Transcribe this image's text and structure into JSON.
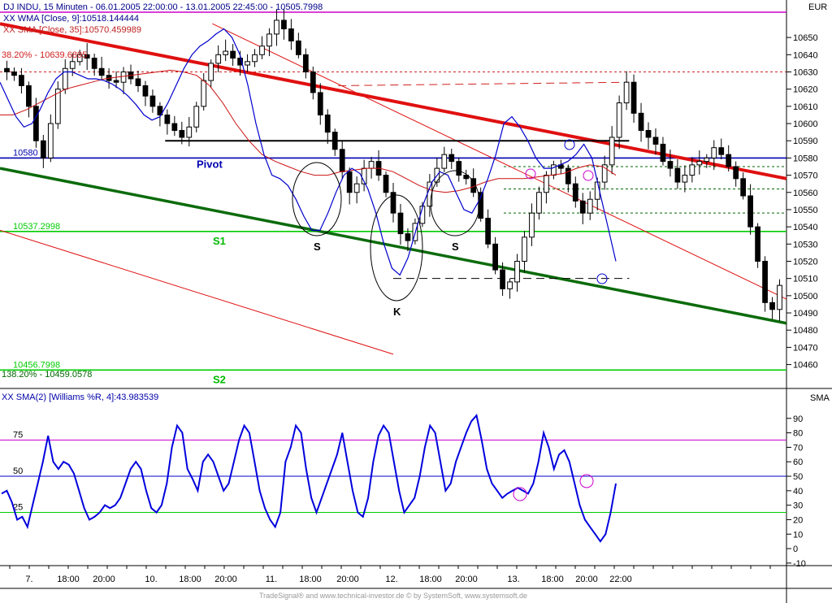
{
  "chart_data": [
    {
      "type": "candlestick",
      "header": {
        "title_lines": [
          "DJ INDU, 15 Minuten - 06.01.2005 22:00:00 - 13.01.2005 22:45:00 - 10505.7998",
          "XX WMA [Close, 9]:10518.144444",
          "XX SMA [Close, 35]:10570.459989"
        ],
        "currency": "EUR",
        "fib_top": "38.20% - 10639.6895",
        "fib_bottom": "138.20% - 10459.0578"
      },
      "y_ticks": [
        10460,
        10470,
        10480,
        10490,
        10500,
        10510,
        10520,
        10530,
        10540,
        10550,
        10560,
        10570,
        10580,
        10590,
        10600,
        10610,
        10620,
        10630,
        10640,
        10650
      ],
      "ylim": [
        10448,
        10668
      ],
      "levels": [
        {
          "name": "Pivot",
          "value": 10580,
          "label": "10580",
          "color": "#0000b0"
        },
        {
          "name": "S1",
          "value": 10537.2998,
          "label": "10537.2998",
          "color": "#00cc00"
        },
        {
          "name": "S2",
          "value": 10456.7998,
          "label": "10456.7998",
          "color": "#00cc00"
        }
      ],
      "level_names": {
        "pivot": "Pivot",
        "s1": "S1",
        "s2": "S2"
      },
      "pattern_labels": [
        "S",
        "K",
        "S"
      ],
      "x_labels": [
        "7.",
        "18:00",
        "20:00",
        "10.",
        "18:00",
        "20:00",
        "11.",
        "18:00",
        "20:00",
        "12.",
        "18:00",
        "20:00",
        "13.",
        "18:00",
        "20:00",
        "22:00"
      ],
      "close_path": [
        10630,
        10628,
        10622,
        10610,
        10590,
        10580,
        10600,
        10620,
        10632,
        10636,
        10640,
        10638,
        10632,
        10628,
        10625,
        10624,
        10630,
        10626,
        10622,
        10616,
        10610,
        10605,
        10600,
        10596,
        10592,
        10598,
        10610,
        10625,
        10635,
        10640,
        10642,
        10638,
        10634,
        10636,
        10640,
        10645,
        10652,
        10660,
        10655,
        10648,
        10640,
        10630,
        10618,
        10605,
        10595,
        10585,
        10572,
        10560,
        10565,
        10574,
        10578,
        10570,
        10560,
        10548,
        10536,
        10532,
        10542,
        10552,
        10566,
        10574,
        10582,
        10578,
        10570,
        10568,
        10560,
        10545,
        10530,
        10515,
        10504,
        10508,
        10520,
        10534,
        10548,
        10560,
        10570,
        10576,
        10574,
        10565,
        10555,
        10548,
        10556,
        10566,
        10576,
        10592,
        10612,
        10624,
        10606,
        10596,
        10592,
        10588,
        10578,
        10574,
        10566,
        10570,
        10576,
        10578,
        10580,
        10586,
        10582,
        10575,
        10568,
        10558,
        10540,
        10520,
        10496,
        10492,
        10506
      ],
      "wma_path": [
        10624,
        10614,
        10604,
        10598,
        10600,
        10608,
        10618,
        10626,
        10630,
        10630,
        10628,
        10626,
        10626,
        10625,
        10623,
        10620,
        10616,
        10611,
        10605,
        10602,
        10604,
        10612,
        10622,
        10632,
        10640,
        10645,
        10648,
        10652,
        10655,
        10650,
        10640,
        10622,
        10600,
        10582,
        10570,
        10568,
        10564,
        10556,
        10546,
        10538,
        10538,
        10548,
        10560,
        10570,
        10574,
        10571,
        10562,
        10548,
        10530,
        10516,
        10512,
        10522,
        10538,
        10554,
        10566,
        10572,
        10570,
        10560,
        10550,
        10548,
        10556,
        10568,
        10582,
        10600,
        10604,
        10598,
        10590,
        10580,
        10574,
        10574,
        10576,
        10578,
        10582,
        10588,
        10580,
        10560,
        10540,
        10520
      ],
      "sma_path": [
        10605,
        10605,
        10608,
        10612,
        10616,
        10620,
        10622,
        10624,
        10626,
        10627,
        10628,
        10629,
        10630,
        10631,
        10630,
        10628,
        10622,
        10612,
        10600,
        10590,
        10582,
        10578,
        10575,
        10572,
        10570,
        10570,
        10572,
        10573,
        10574,
        10574,
        10572,
        10568,
        10564,
        10561,
        10560,
        10561,
        10563,
        10566,
        10568,
        10568,
        10568,
        10569,
        10570,
        10571,
        10574,
        10576,
        10575,
        10570
      ],
      "channel_lines": [
        {
          "name": "upper-resistance",
          "from": [
            0,
            10658
          ],
          "to": [
            1,
            10568
          ],
          "color": "#e01010",
          "width": 4
        },
        {
          "name": "lower-support",
          "from": [
            0,
            10574
          ],
          "to": [
            1,
            10484
          ],
          "color": "#0b6b0b",
          "width": 3.5
        },
        {
          "name": "thin-red-upper",
          "from": [
            0.27,
            10658
          ],
          "to": [
            1,
            10498
          ],
          "color": "#e01010",
          "width": 1
        },
        {
          "name": "thin-red-lower",
          "from": [
            0,
            10538
          ],
          "to": [
            0.5,
            10466
          ],
          "color": "#e01010",
          "width": 1
        }
      ],
      "annotation_lines": [
        {
          "name": "neckline-black",
          "from": [
            0.21,
            10590
          ],
          "to": [
            0.8,
            10590
          ],
          "color": "#000000",
          "width": 2
        },
        {
          "name": "dash-red-top",
          "from": [
            0.43,
            10622
          ],
          "to": [
            0.8,
            10624
          ],
          "color": "#d02020",
          "width": 1
        },
        {
          "name": "dash-black-target",
          "from": [
            0.5,
            10510
          ],
          "to": [
            0.8,
            10510
          ],
          "color": "#000000",
          "width": 1
        }
      ],
      "dotted_levels": [
        10630,
        10575,
        10562,
        10548
      ]
    },
    {
      "type": "line",
      "title": "XX SMA(2) [Williams %R, 4]:43.983539",
      "panel_label": "SMA",
      "y_ticks": [
        -10,
        0,
        10,
        20,
        30,
        40,
        50,
        60,
        70,
        80,
        90
      ],
      "ylim": [
        -14,
        100
      ],
      "ref_lines": [
        {
          "value": 75,
          "label": "75",
          "color": "#cc00cc"
        },
        {
          "value": 50,
          "label": "50",
          "color": "#0000cc"
        },
        {
          "value": 25,
          "label": "25",
          "color": "#00cc00"
        }
      ],
      "values": [
        38,
        40,
        32,
        20,
        22,
        15,
        30,
        45,
        60,
        78,
        60,
        55,
        60,
        58,
        52,
        40,
        28,
        20,
        22,
        25,
        30,
        28,
        30,
        35,
        45,
        55,
        60,
        55,
        40,
        28,
        25,
        30,
        45,
        70,
        85,
        80,
        55,
        48,
        40,
        60,
        65,
        60,
        50,
        40,
        45,
        60,
        75,
        85,
        80,
        60,
        40,
        28,
        20,
        15,
        25,
        60,
        70,
        85,
        80,
        55,
        35,
        25,
        35,
        45,
        55,
        65,
        80,
        60,
        40,
        25,
        22,
        35,
        60,
        78,
        85,
        80,
        60,
        40,
        25,
        30,
        35,
        50,
        70,
        85,
        80,
        60,
        40,
        45,
        60,
        70,
        80,
        88,
        92,
        75,
        55,
        45,
        40,
        35,
        38,
        40,
        42,
        40,
        38,
        45,
        60,
        80,
        70,
        55,
        65,
        68,
        60,
        45,
        30,
        20,
        15,
        10,
        5,
        10,
        25,
        45
      ]
    }
  ],
  "footer": "TradeSignal® and www.technical-investor.de © by SystemSoft, www.systemsoft.de"
}
